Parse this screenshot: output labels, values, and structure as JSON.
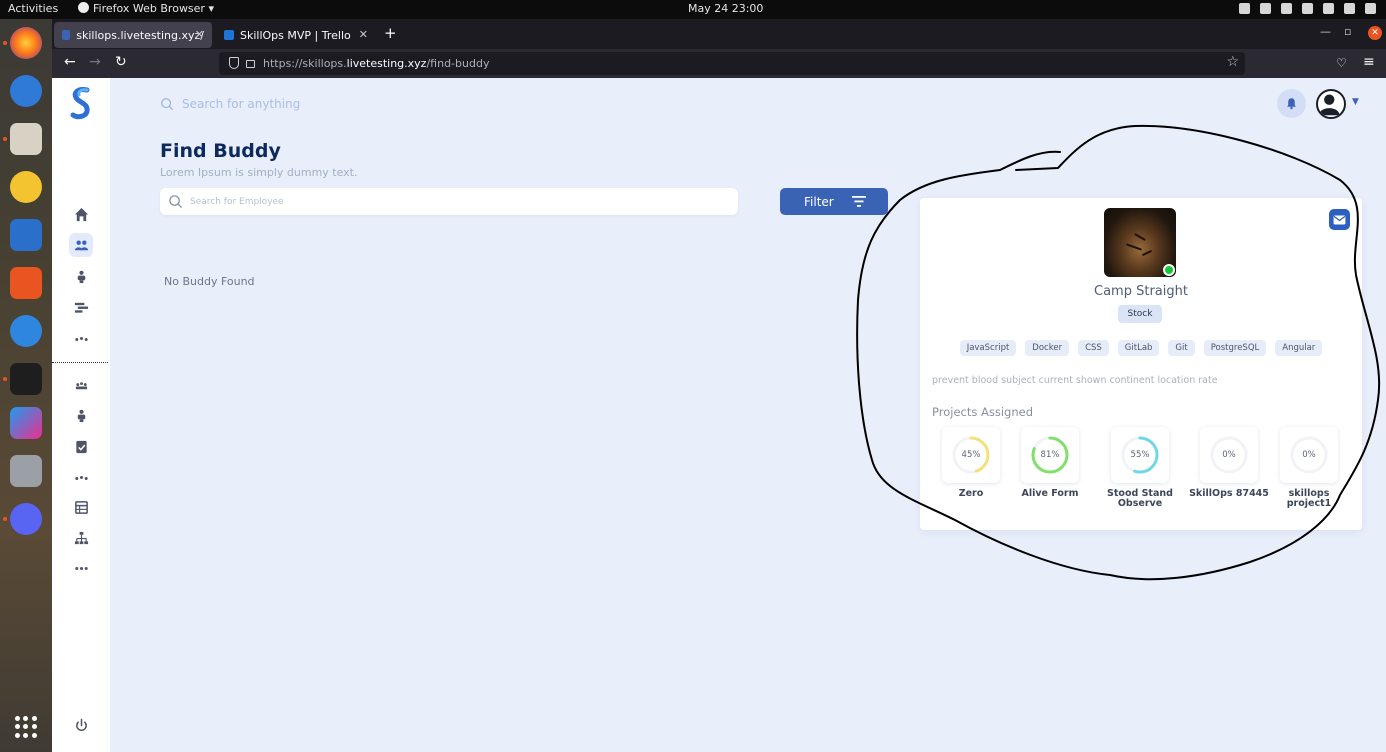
{
  "system_bar": {
    "activities": "Activities",
    "app_name": "Firefox Web Browser ▾",
    "clock": "May 24  23:00"
  },
  "browser": {
    "tabs": [
      {
        "title": "skillops.livetesting.xyz/",
        "active": true
      },
      {
        "title": "SkillOps MVP | Trello",
        "active": false
      }
    ],
    "url_prefix": "https://skillops.",
    "url_domain": "livetesting.xyz",
    "url_path": "/find-buddy"
  },
  "header": {
    "search_placeholder": "Search for anything"
  },
  "page": {
    "title": "Find Buddy",
    "subtitle": "Lorem Ipsum is simply dummy text.",
    "employee_search_placeholder": "Search for Employee",
    "filter_label": "Filter",
    "empty_message": "No Buddy Found"
  },
  "buddy": {
    "name": "Camp Straight",
    "role": "Stock",
    "online": true,
    "skills": [
      "JavaScript",
      "Docker",
      "CSS",
      "GitLab",
      "Git",
      "PostgreSQL",
      "Angular"
    ],
    "description": "prevent blood subject current shown continent location rate",
    "projects_heading": "Projects Assigned",
    "projects": [
      {
        "name": "Zero",
        "progress": 45,
        "label": "45%",
        "color": "#f2e27a"
      },
      {
        "name": "Alive Form",
        "progress": 81,
        "label": "81%",
        "color": "#7fe06a"
      },
      {
        "name": "Stood Stand Observe",
        "progress": 55,
        "label": "55%",
        "color": "#6fd8e8"
      },
      {
        "name": "SkillOps 87445",
        "progress": 0,
        "label": "0%",
        "color": "#cccccc"
      },
      {
        "name": "skillops project1",
        "progress": 0,
        "label": "0%",
        "color": "#cccccc"
      }
    ]
  },
  "colors": {
    "accent": "#3b63b5",
    "title": "#0d2a5c",
    "page_bg": "#e9eefb"
  }
}
